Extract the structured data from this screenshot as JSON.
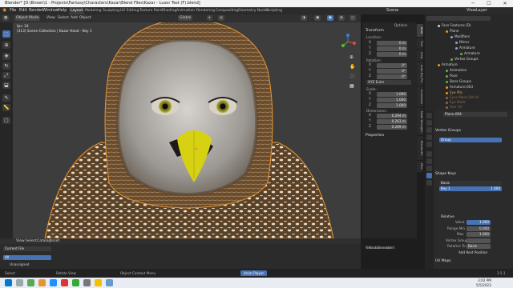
{
  "titlebar": {
    "title": "Blender* [D:\\Brown\\1 - Projects\\Fantasy\\Characters\\Kazar\\Blend Files\\Kazar - Luxor Test (F).blend]",
    "minimize": "─",
    "maximize": "☐",
    "close": "✕"
  },
  "menu": [
    "File",
    "Edit",
    "Render",
    "Window",
    "Help"
  ],
  "workspaces": [
    "Layout",
    "Modeling",
    "Sculpting",
    "UV Editing",
    "Texture Paint",
    "Shading",
    "Animation",
    "Rendering",
    "Compositing",
    "Geometry Nodes",
    "Scripting"
  ],
  "scene": {
    "name": "Scene",
    "view_layer": "ViewLayer"
  },
  "header": {
    "mode": "Object Mode",
    "items": [
      "View",
      "Select",
      "Add",
      "Object"
    ],
    "transform": "Global"
  },
  "viewport": {
    "overlay_line1": "fps: 24",
    "overlay_line2": "(313) Scene Collection | Kazar Head - Key 1"
  },
  "npanel": {
    "transform_title": "Transform",
    "location_label": "Location:",
    "location": [
      {
        "axis": "X",
        "value": "0 m"
      },
      {
        "axis": "Y",
        "value": "0 m"
      },
      {
        "axis": "Z",
        "value": "0 m"
      }
    ],
    "rotation_label": "Rotation:",
    "rotation": [
      {
        "axis": "X",
        "value": "0°"
      },
      {
        "axis": "Y",
        "value": "0°"
      },
      {
        "axis": "Z",
        "value": "0°"
      }
    ],
    "rotation_mode": "XYZ Euler",
    "scale_label": "Scale:",
    "scale": [
      {
        "axis": "X",
        "value": "1.000"
      },
      {
        "axis": "Y",
        "value": "1.000"
      },
      {
        "axis": "Z",
        "value": "1.000"
      }
    ],
    "dimensions_label": "Dimensions:",
    "dimensions": [
      {
        "axis": "X",
        "value": "0.294 m"
      },
      {
        "axis": "Y",
        "value": "0.263 m"
      },
      {
        "axis": "Z",
        "value": "0.269 m"
      }
    ],
    "properties_title": "Properties",
    "options": "Options"
  },
  "vtabs": [
    "Item",
    "Tool",
    "View",
    "Auto-Rig Pro",
    "Animation",
    "Node Wrangler",
    "BlenderKit",
    "Misc"
  ],
  "outliner": {
    "rows": [
      "Face Features (D)",
      "Plane",
      "Modifiers",
      "Mirror",
      "Armature",
      "Armature",
      "Vertex Groups",
      "Armature",
      "Animation",
      "Pose",
      "Bone Groups",
      "Armature.003",
      "Eye Mix",
      "Eyes Mask Def Id",
      "Eye Mask",
      "Hair (S)"
    ]
  },
  "props": {
    "object_name": "Plane.004",
    "vertex_groups_title": "Vertex Groups",
    "vg_item": "Group",
    "shape_keys_title": "Shape Keys",
    "sk_items": [
      {
        "name": "Basis",
        "value": ""
      },
      {
        "name": "Key 1",
        "value": "1.000"
      }
    ],
    "relative_label": "Relative",
    "value_label": "Value",
    "value": "1.000",
    "range_min_label": "Range Min",
    "range_min": "0.000",
    "max_label": "Max",
    "max": "1.000",
    "vertex_group_label": "Vertex Group",
    "relative_to_label": "Relative To",
    "relative_to": "Basis",
    "add_rest_position": "Add Rest Position",
    "uv_maps_title": "UV Maps"
  },
  "filebrowser": {
    "items": [
      "View",
      "Select",
      "Catalog",
      "Asset"
    ],
    "library": "Current File",
    "all": "All",
    "unassigned": "Unassigned",
    "no_items": "No active asset"
  },
  "statusbar": {
    "select": "Select",
    "rotate": "Rotate View",
    "context": "Object Context Menu",
    "anim": "Anim Player",
    "version": "3.5.1"
  },
  "taskbar": {
    "time": "3:02 PM",
    "date": "5/5/2023"
  },
  "colors": {
    "accent": "#4772b3",
    "selection": "#e8952f",
    "bg": "#3d3d3d"
  }
}
